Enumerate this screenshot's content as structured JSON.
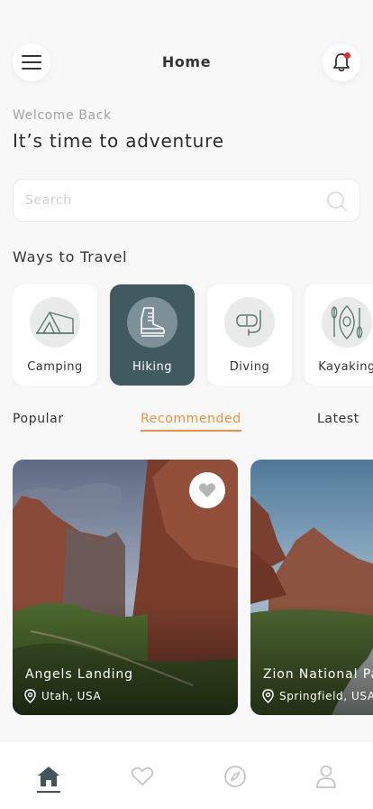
{
  "header": {
    "title": "Home",
    "has_notification": true
  },
  "welcome": {
    "subtitle": "Welcome Back",
    "headline": "It’s time to adventure"
  },
  "search": {
    "placeholder": "Search",
    "value": ""
  },
  "ways_to_travel": {
    "title": "Ways to Travel",
    "items": [
      {
        "label": "Camping",
        "icon": "tent-icon",
        "active": false
      },
      {
        "label": "Hiking",
        "icon": "hiking-boot-icon",
        "active": true
      },
      {
        "label": "Diving",
        "icon": "diving-mask-icon",
        "active": false
      },
      {
        "label": "Kayaking",
        "icon": "kayak-paddle-icon",
        "active": false
      }
    ]
  },
  "tabs": {
    "items": [
      "Popular",
      "Recommended",
      "Latest"
    ],
    "active": "Recommended"
  },
  "places": [
    {
      "name": "Angels Landing",
      "location": "Utah, USA",
      "favorite_icon": "heart-icon"
    },
    {
      "name": "Zion National Park",
      "location": "Springfield, USA"
    }
  ],
  "bottom_nav": {
    "items": [
      "home-icon",
      "heart-icon",
      "compass-icon",
      "profile-icon"
    ],
    "active": "home-icon"
  },
  "colors": {
    "accent": "#f0913c",
    "active_card": "#415a5f",
    "notification": "#e8282d",
    "text_dark": "#2c2c2c",
    "text_muted": "#a2a2a2"
  }
}
